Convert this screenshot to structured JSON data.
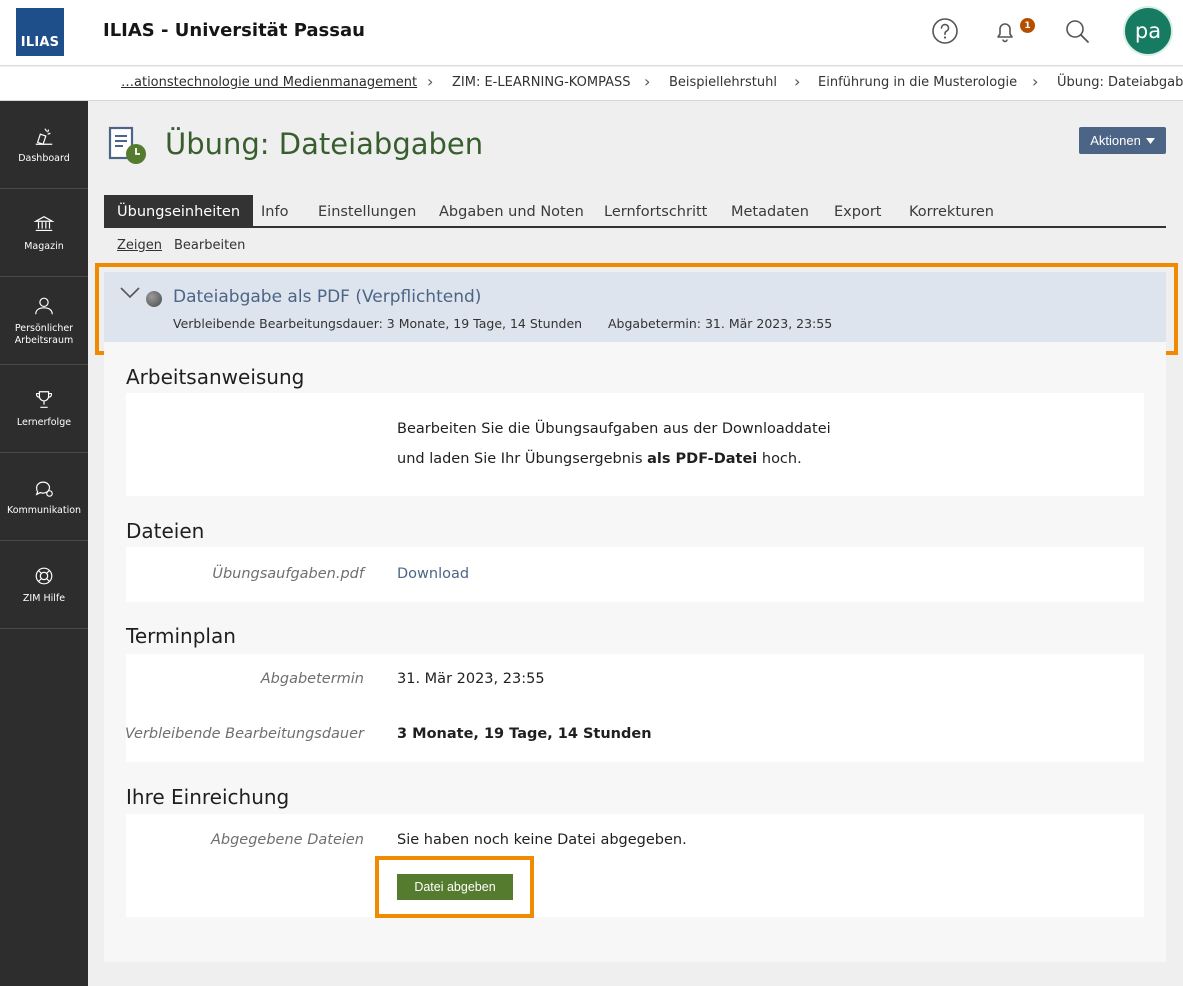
{
  "header": {
    "logo": "ILIAS",
    "title": "ILIAS - Universität Passau",
    "notification_count": "1",
    "avatar_initials": "pa"
  },
  "breadcrumb": {
    "items": [
      "…ationstechnologie und Medienmanagement",
      "ZIM: E-LEARNING-KOMPASS",
      "Beispiellehrstuhl",
      "Einführung in die Musterologie",
      "Übung: Dateiabgaben"
    ]
  },
  "sidebar": {
    "items": [
      {
        "label": "Dashboard",
        "icon": "dashboard-icon"
      },
      {
        "label": "Magazin",
        "icon": "repository-icon"
      },
      {
        "label": "Persönlicher Arbeitsraum",
        "icon": "person-icon"
      },
      {
        "label": "Lernerfolge",
        "icon": "trophy-icon"
      },
      {
        "label": "Kommunikation",
        "icon": "chat-icon"
      },
      {
        "label": "ZIM Hilfe",
        "icon": "lifebuoy-icon"
      }
    ]
  },
  "page": {
    "title": "Übung: Dateiabgaben",
    "actions_label": "Aktionen"
  },
  "tabs": [
    "Übungseinheiten",
    "Info",
    "Einstellungen",
    "Abgaben und Noten",
    "Lernfortschritt",
    "Metadaten",
    "Export",
    "Korrekturen"
  ],
  "subtabs": [
    "Zeigen",
    "Bearbeiten"
  ],
  "assignment": {
    "title": "Dateiabgabe als PDF (Verpflichtend)",
    "remaining": "Verbleibende Bearbeitungsdauer: 3 Monate, 19 Tage, 14 Stunden",
    "deadline": "Abgabetermin: 31. Mär 2023, 23:55"
  },
  "sections": {
    "instructions": {
      "title": "Arbeitsanweisung",
      "line1": "Bearbeiten Sie die Übungsaufgaben aus der Downloaddatei",
      "line2_prefix": "und laden Sie Ihr Übungsergebnis ",
      "line2_bold": "als PDF-Datei",
      "line2_suffix": " hoch."
    },
    "files": {
      "title": "Dateien",
      "file_name": "Übungsaufgaben.pdf",
      "download_label": "Download"
    },
    "schedule": {
      "title": "Terminplan",
      "deadline_label": "Abgabetermin",
      "deadline_value": "31. Mär 2023, 23:55",
      "remaining_label": "Verbleibende Bearbeitungsdauer",
      "remaining_value": "3 Monate, 19 Tage, 14 Stunden"
    },
    "submission": {
      "title": "Ihre Einreichung",
      "files_label": "Abgegebene Dateien",
      "files_value": "Sie haben noch keine Datei abgegeben.",
      "submit_label": "Datei abgeben"
    }
  }
}
